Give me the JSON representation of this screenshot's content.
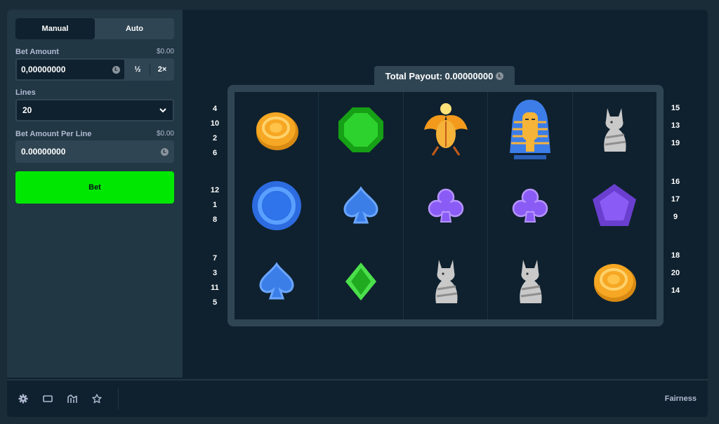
{
  "tabs": {
    "manual": "Manual",
    "auto": "Auto"
  },
  "bet_amount": {
    "label": "Bet Amount",
    "usd": "$0.00",
    "value": "0,00000000",
    "half": "½",
    "double": "2×"
  },
  "lines": {
    "label": "Lines",
    "value": "20"
  },
  "per_line": {
    "label": "Bet Amount Per Line",
    "usd": "$0.00",
    "value": "0.00000000"
  },
  "bet_button": "Bet",
  "payout": {
    "label": "Total Payout: 0.00000000"
  },
  "paylines_left": [
    [
      "4",
      "10",
      "2",
      "6"
    ],
    [
      "12",
      "1",
      "8"
    ],
    [
      "7",
      "3",
      "11",
      "5"
    ]
  ],
  "paylines_right": [
    [
      "15",
      "13",
      "19"
    ],
    [
      "16",
      "17",
      "9"
    ],
    [
      "18",
      "20",
      "14"
    ]
  ],
  "reels": [
    [
      "gold-coin",
      "blue-ring",
      "blue-spade"
    ],
    [
      "green-gem",
      "blue-spade",
      "green-diamond"
    ],
    [
      "scarab",
      "purple-club",
      "cat-statue"
    ],
    [
      "pharaoh",
      "purple-club",
      "cat-statue"
    ],
    [
      "cat-statue",
      "purple-pentagon",
      "gold-coin"
    ]
  ],
  "footer": {
    "fairness": "Fairness",
    "icons": [
      "gear-icon",
      "theatre-mode-icon",
      "stats-icon",
      "favourite-icon"
    ]
  },
  "colors": {
    "bet": "#00e701",
    "panel": "#213743",
    "bg": "#0f212e"
  }
}
